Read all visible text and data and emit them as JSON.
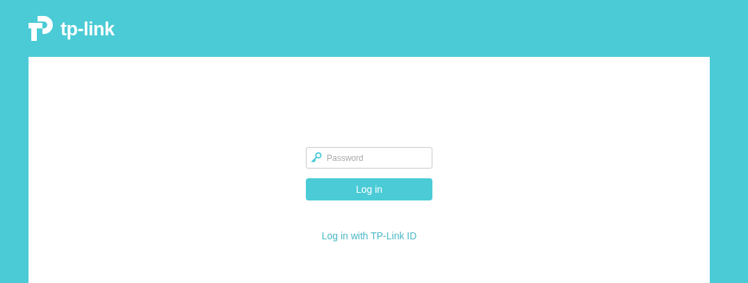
{
  "header": {
    "logo_text": "tp-link"
  },
  "login": {
    "password": {
      "placeholder": "Password"
    },
    "button": "Log in",
    "link": "Log in with TP-Link ID"
  }
}
